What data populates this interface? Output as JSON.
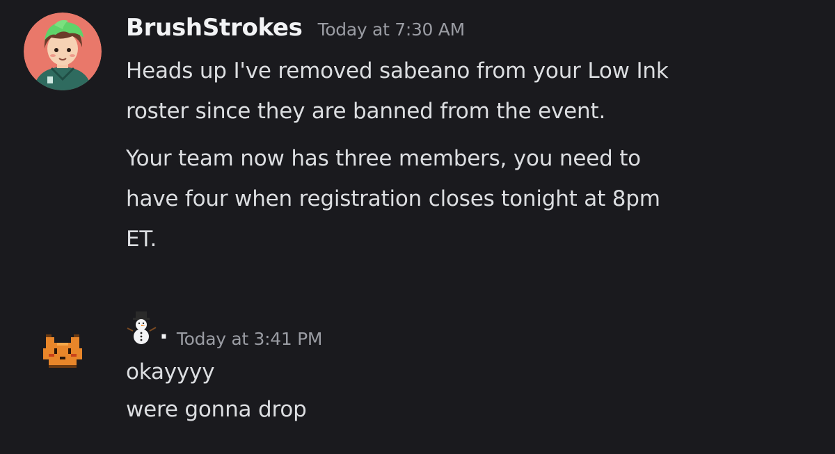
{
  "messages": [
    {
      "username": "BrushStrokes",
      "timestamp": "Today at 7:30 AM",
      "avatar": "green-haired-character-avatar",
      "paragraphs": [
        [
          "Heads up I've removed sabeano from your Low Ink",
          "roster since they are banned from the event."
        ],
        [
          "Your team now has three members, you need to",
          "have four when registration closes tonight at 8pm",
          "ET."
        ]
      ]
    },
    {
      "username_icon": "snowman-icon",
      "username_suffix": ".",
      "timestamp": "Today at 3:41 PM",
      "avatar": "pixel-cat-avatar",
      "lines": [
        "okayyyy",
        "were gonna drop"
      ]
    }
  ],
  "colors": {
    "background": "#1a1a1e",
    "username": "#f2f3f5",
    "message_text": "#dcdee1",
    "timestamp": "#9a9ca3",
    "avatar_bg": "#e9786a",
    "pixel_avatar": "#e8862a"
  }
}
